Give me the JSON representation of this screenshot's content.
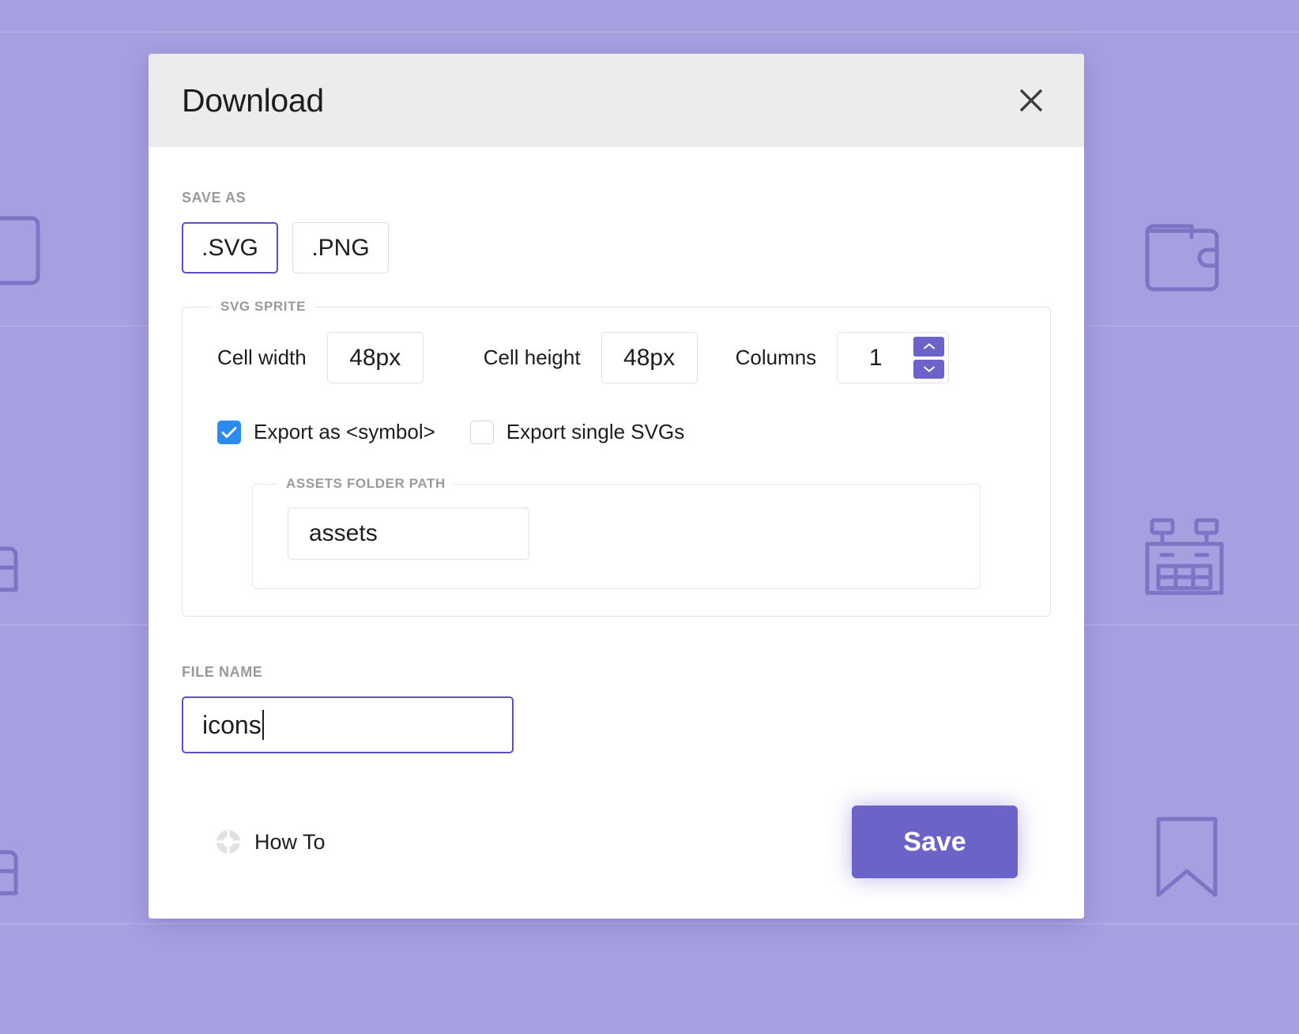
{
  "dialog": {
    "title": "Download",
    "close_icon": "close-icon"
  },
  "save_as": {
    "label": "SAVE AS",
    "options": [
      {
        "label": ".SVG",
        "selected": true
      },
      {
        "label": ".PNG",
        "selected": false
      }
    ]
  },
  "svg_sprite": {
    "legend": "SVG SPRITE",
    "cell_width": {
      "label": "Cell width",
      "value": "48px"
    },
    "cell_height": {
      "label": "Cell height",
      "value": "48px"
    },
    "columns": {
      "label": "Columns",
      "value": "1",
      "up_icon": "chevron-up-icon",
      "down_icon": "chevron-down-icon"
    },
    "checkboxes": [
      {
        "label": "Export as <symbol>",
        "checked": true
      },
      {
        "label": "Export single SVGs",
        "checked": false
      }
    ],
    "assets_folder": {
      "legend": "ASSETS FOLDER PATH",
      "value": "assets"
    }
  },
  "file_name": {
    "label": "FILE NAME",
    "value": "icons"
  },
  "footer": {
    "how_to_label": "How To",
    "how_to_icon": "help-circle-icon",
    "save_label": "Save"
  },
  "colors": {
    "accent_purple": "#6c63c8",
    "selected_border": "#5b4fc4",
    "checkbox_blue": "#2b8cf0",
    "background": "#a5a0e0",
    "header_bg": "#ececec",
    "label_gray": "#9a9a9a"
  },
  "background_icons": [
    "book-icon",
    "wallet-icon",
    "cake-icon",
    "calendar-icon",
    "cake-icon",
    "bookmark-icon"
  ]
}
